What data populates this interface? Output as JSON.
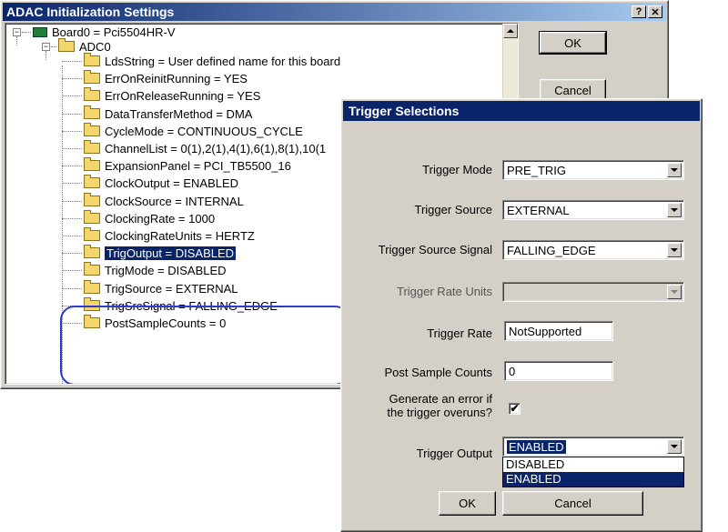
{
  "main_window": {
    "title": "ADAC Initialization Settings",
    "help_label": "?",
    "close_label": "✕",
    "ok_label": "OK",
    "cancel_label": "Cancel",
    "tree": {
      "root": "Board0 = Pci5504HR-V",
      "group": "ADC0",
      "items": [
        "LdsString = User defined name for this board",
        "ErrOnReinitRunning = YES",
        "ErrOnReleaseRunning = YES",
        "DataTransferMethod = DMA",
        "CycleMode = CONTINUOUS_CYCLE",
        "ChannelList = 0(1),2(1),4(1),6(1),8(1),10(1",
        "ExpansionPanel = PCI_TB5500_16",
        "ClockOutput = ENABLED",
        "ClockSource = INTERNAL",
        "ClockingRate = 1000",
        "ClockingRateUnits = HERTZ",
        "TrigOutput = DISABLED",
        "TrigMode = DISABLED",
        "TrigSource = EXTERNAL",
        "TrigSrcSignal = FALLING_EDGE",
        "PostSampleCounts = 0"
      ]
    }
  },
  "trigger_dialog": {
    "title": "Trigger Selections",
    "trigger_mode": {
      "label": "Trigger Mode",
      "value": "PRE_TRIG"
    },
    "trigger_source": {
      "label": "Trigger Source",
      "value": "EXTERNAL"
    },
    "trigger_source_signal": {
      "label": "Trigger Source Signal",
      "value": "FALLING_EDGE"
    },
    "trigger_rate_units": {
      "label": "Trigger Rate Units",
      "value": ""
    },
    "trigger_rate": {
      "label": "Trigger Rate",
      "value": "NotSupported"
    },
    "post_sample_counts": {
      "label": "Post Sample Counts",
      "value": "0"
    },
    "overrun_error": {
      "label_line1": "Generate an error if",
      "label_line2": "the trigger overuns?",
      "checked_mark": "✔"
    },
    "trigger_output": {
      "label": "Trigger Output",
      "value": "ENABLED",
      "options": [
        "DISABLED",
        "ENABLED"
      ]
    },
    "ok_label": "OK",
    "cancel_label": "Cancel"
  },
  "colors": {
    "titlebar_active": "#0a246a",
    "selection": "#0a246a",
    "highlight_oval": "#2d3bd0",
    "face": "#d4d0c8"
  }
}
